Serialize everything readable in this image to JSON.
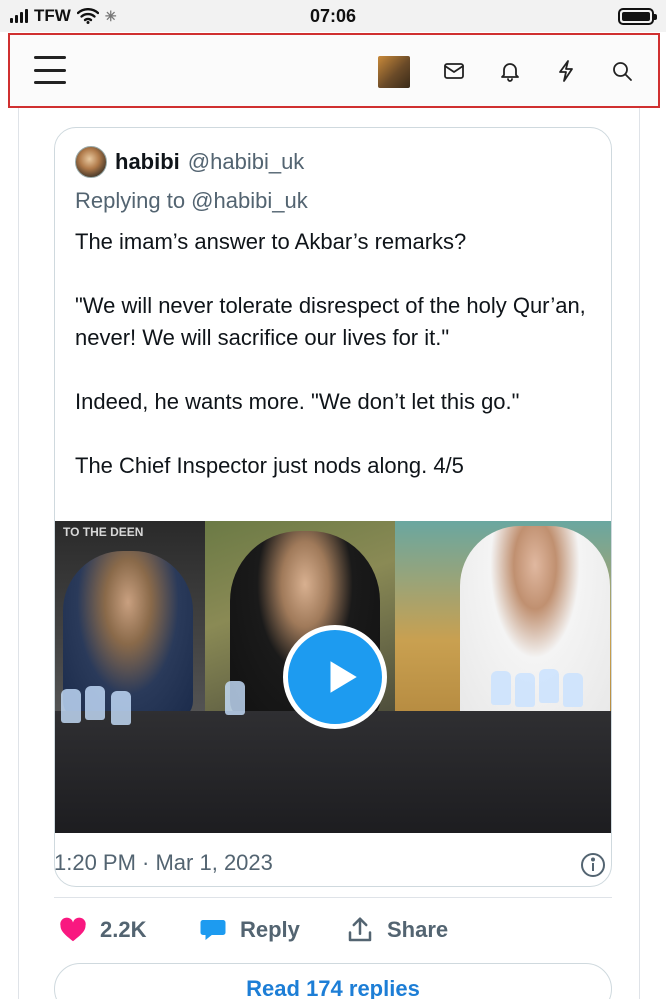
{
  "status_bar": {
    "carrier": "TFW",
    "time": "07:06"
  },
  "header": {
    "icons": [
      "menu-icon",
      "mail-icon",
      "bell-icon",
      "lightning-icon",
      "search-icon"
    ]
  },
  "tweet": {
    "author_name": "habibi",
    "author_handle": "@habibi_uk",
    "replying_to": "Replying to @habibi_uk",
    "paragraphs": [
      "The imam’s answer to Akbar’s remarks?",
      "\"We will never tolerate disrespect of the holy Qur’an, never! We will sacrifice our lives for it.\"",
      "Indeed, he wants more. \"We don’t let this go.\"",
      "The Chief Inspector just nods along. 4/5"
    ],
    "video_caption": "TO THE DEEN",
    "timestamp": "1:20 PM · Mar 1, 2023",
    "like_count": "2.2K",
    "reply_label": "Reply",
    "share_label": "Share",
    "read_replies_label": "Read 174 replies"
  },
  "colors": {
    "accent_blue": "#1d9bf0",
    "like_pink": "#f91880",
    "header_border": "#d03030",
    "muted_text": "#536471"
  }
}
